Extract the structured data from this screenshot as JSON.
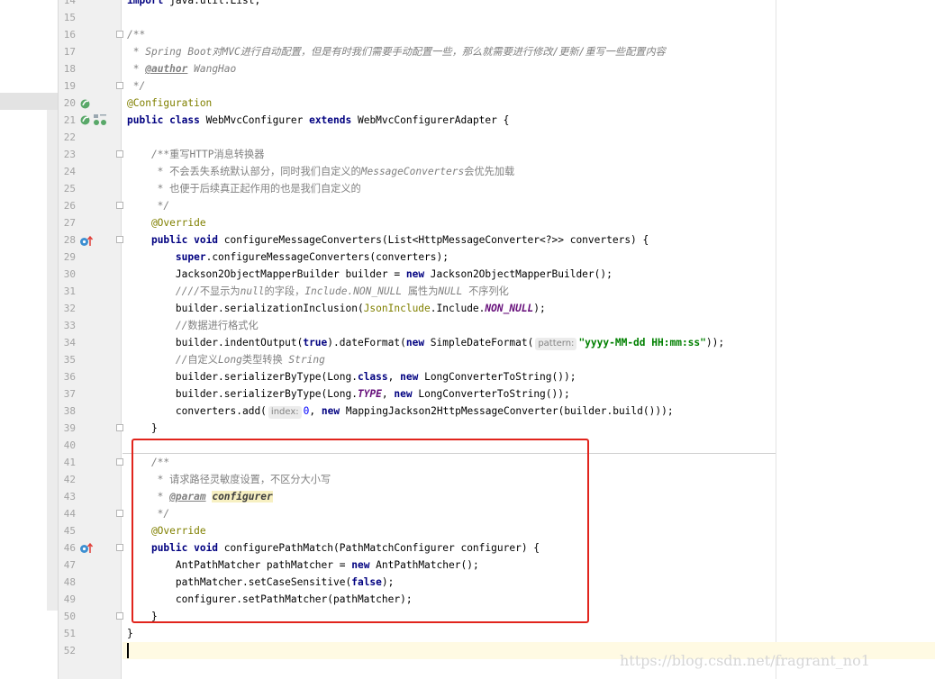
{
  "editor": {
    "lines": [
      {
        "n": "14",
        "segs": [
          {
            "t": "import",
            "c": "kw"
          },
          {
            "t": " java.util.List;"
          }
        ]
      },
      {
        "n": "15",
        "segs": []
      },
      {
        "n": "16",
        "segs": [
          {
            "t": "/**",
            "c": "cm"
          }
        ],
        "fold": true
      },
      {
        "n": "17",
        "segs": [
          {
            "t": " * Spring Boot对MVC进行自动配置，但是有时我们需要手动配置一些，那么就需要进行修改/更新/重写一些配置内容",
            "c": "cm"
          }
        ]
      },
      {
        "n": "18",
        "segs": [
          {
            "t": " * ",
            "c": "cm"
          },
          {
            "t": "@author",
            "c": "doctag"
          },
          {
            "t": " WangHao",
            "c": "cm"
          }
        ]
      },
      {
        "n": "19",
        "segs": [
          {
            "t": " */",
            "c": "cm"
          }
        ],
        "fold": true
      },
      {
        "n": "20",
        "segs": [
          {
            "t": "@Configuration",
            "c": "ann"
          }
        ]
      },
      {
        "n": "21",
        "segs": [
          {
            "t": "public class",
            "c": "kw"
          },
          {
            "t": " WebMvcConfigurer "
          },
          {
            "t": "extends",
            "c": "kw"
          },
          {
            "t": " WebMvcConfigurerAdapter {"
          }
        ]
      },
      {
        "n": "22",
        "segs": []
      },
      {
        "n": "23",
        "segs": [
          {
            "t": "    /**",
            "c": "cm"
          },
          {
            "t": "重写HTTP消息转换器",
            "c": "cmz"
          }
        ],
        "fold": true
      },
      {
        "n": "24",
        "segs": [
          {
            "t": "     * ",
            "c": "cm"
          },
          {
            "t": "不会丢失系统默认部分，同时我们自定义的",
            "c": "cmz"
          },
          {
            "t": "MessageConverters",
            "c": "cm"
          },
          {
            "t": "会优先加载",
            "c": "cmz"
          }
        ]
      },
      {
        "n": "25",
        "segs": [
          {
            "t": "     * ",
            "c": "cm"
          },
          {
            "t": "也便于后续真正起作用的也是我们自定义的",
            "c": "cmz"
          }
        ]
      },
      {
        "n": "26",
        "segs": [
          {
            "t": "     */",
            "c": "cm"
          }
        ],
        "fold": true
      },
      {
        "n": "27",
        "segs": [
          {
            "t": "    @Override",
            "c": "ann"
          }
        ]
      },
      {
        "n": "28",
        "segs": [
          {
            "t": "    "
          },
          {
            "t": "public void",
            "c": "kw"
          },
          {
            "t": " configureMessageConverters(List<HttpMessageConverter<?>> converters) {"
          }
        ],
        "fold": true
      },
      {
        "n": "29",
        "segs": [
          {
            "t": "        "
          },
          {
            "t": "super",
            "c": "kw"
          },
          {
            "t": ".configureMessageConverters(converters);"
          }
        ]
      },
      {
        "n": "30",
        "segs": [
          {
            "t": "        Jackson2ObjectMapperBuilder builder = "
          },
          {
            "t": "new",
            "c": "kw"
          },
          {
            "t": " Jackson2ObjectMapperBuilder();"
          }
        ]
      },
      {
        "n": "31",
        "segs": [
          {
            "t": "        ////",
            "c": "cm"
          },
          {
            "t": "不显示为",
            "c": "cmz"
          },
          {
            "t": "null",
            "c": "cm"
          },
          {
            "t": "的字段，",
            "c": "cmz"
          },
          {
            "t": "Include.NON_NULL",
            "c": "cm"
          },
          {
            "t": " 属性为",
            "c": "cmz"
          },
          {
            "t": "NULL",
            "c": "cm"
          },
          {
            "t": " 不序列化",
            "c": "cmz"
          }
        ]
      },
      {
        "n": "32",
        "segs": [
          {
            "t": "        builder.serializationInclusion("
          },
          {
            "t": "JsonInclude",
            "c": "cls"
          },
          {
            "t": ".Include."
          },
          {
            "t": "NON_NULL",
            "c": "st"
          },
          {
            "t": ");"
          }
        ]
      },
      {
        "n": "33",
        "segs": [
          {
            "t": "        //",
            "c": "cm"
          },
          {
            "t": "数据进行格式化",
            "c": "cmz"
          }
        ]
      },
      {
        "n": "34",
        "segs": [
          {
            "t": "        builder.indentOutput("
          },
          {
            "t": "true",
            "c": "kw"
          },
          {
            "t": ").dateFormat("
          },
          {
            "t": "new",
            "c": "kw"
          },
          {
            "t": " SimpleDateFormat("
          },
          {
            "t": "pattern:",
            "c": "hint"
          },
          {
            "t": "\"yyyy-MM-dd HH:mm:ss\"",
            "c": "str"
          },
          {
            "t": "));"
          }
        ]
      },
      {
        "n": "35",
        "segs": [
          {
            "t": "        //",
            "c": "cm"
          },
          {
            "t": "自定义",
            "c": "cmz"
          },
          {
            "t": "Long",
            "c": "cm"
          },
          {
            "t": "类型转换 ",
            "c": "cmz"
          },
          {
            "t": "String",
            "c": "cm"
          }
        ]
      },
      {
        "n": "36",
        "segs": [
          {
            "t": "        builder.serializerByType(Long."
          },
          {
            "t": "class",
            "c": "kw"
          },
          {
            "t": ", "
          },
          {
            "t": "new",
            "c": "kw"
          },
          {
            "t": " LongConverterToString());"
          }
        ]
      },
      {
        "n": "37",
        "segs": [
          {
            "t": "        builder.serializerByType(Long."
          },
          {
            "t": "TYPE",
            "c": "st"
          },
          {
            "t": ", "
          },
          {
            "t": "new",
            "c": "kw"
          },
          {
            "t": " LongConverterToString());"
          }
        ]
      },
      {
        "n": "38",
        "segs": [
          {
            "t": "        converters.add("
          },
          {
            "t": "index:",
            "c": "hint"
          },
          {
            "t": "0",
            "c": "num"
          },
          {
            "t": ", "
          },
          {
            "t": "new",
            "c": "kw"
          },
          {
            "t": " MappingJackson2HttpMessageConverter(builder.build()));"
          }
        ]
      },
      {
        "n": "39",
        "segs": [
          {
            "t": "    }"
          }
        ],
        "fold": true
      },
      {
        "n": "40",
        "segs": []
      },
      {
        "n": "41",
        "segs": [
          {
            "t": "    /**",
            "c": "cm"
          }
        ],
        "fold": true
      },
      {
        "n": "42",
        "segs": [
          {
            "t": "     * ",
            "c": "cm"
          },
          {
            "t": "请求路径灵敏度设置，不区分大小写",
            "c": "cmz"
          }
        ]
      },
      {
        "n": "43",
        "segs": [
          {
            "t": "     * ",
            "c": "cm"
          },
          {
            "t": "@param",
            "c": "doctag"
          },
          {
            "t": " "
          },
          {
            "t": "configurer",
            "c": "docparam"
          }
        ]
      },
      {
        "n": "44",
        "segs": [
          {
            "t": "     */",
            "c": "cm"
          }
        ],
        "fold": true
      },
      {
        "n": "45",
        "segs": [
          {
            "t": "    @Override",
            "c": "ann"
          }
        ]
      },
      {
        "n": "46",
        "segs": [
          {
            "t": "    "
          },
          {
            "t": "public void",
            "c": "kw"
          },
          {
            "t": " configurePathMatch(PathMatchConfigurer configurer) {"
          }
        ],
        "fold": true
      },
      {
        "n": "47",
        "segs": [
          {
            "t": "        AntPathMatcher pathMatcher = "
          },
          {
            "t": "new",
            "c": "kw"
          },
          {
            "t": " AntPathMatcher();"
          }
        ]
      },
      {
        "n": "48",
        "segs": [
          {
            "t": "        pathMatcher.setCaseSensitive("
          },
          {
            "t": "false",
            "c": "kw"
          },
          {
            "t": ");"
          }
        ]
      },
      {
        "n": "49",
        "segs": [
          {
            "t": "        configurer.setPathMatcher(pathMatcher);"
          }
        ]
      },
      {
        "n": "50",
        "segs": [
          {
            "t": "    }"
          }
        ],
        "fold": true
      },
      {
        "n": "51",
        "segs": [
          {
            "t": "}"
          }
        ]
      },
      {
        "n": "52",
        "segs": []
      }
    ]
  },
  "gutter_icons": {
    "spring_bean": "spring-bean-icon",
    "spring_bean_with_link": "spring-bean-navigate-icon",
    "override_method": "override-method-icon"
  },
  "watermark": "https://blog.csdn.net/fragrant_no1"
}
